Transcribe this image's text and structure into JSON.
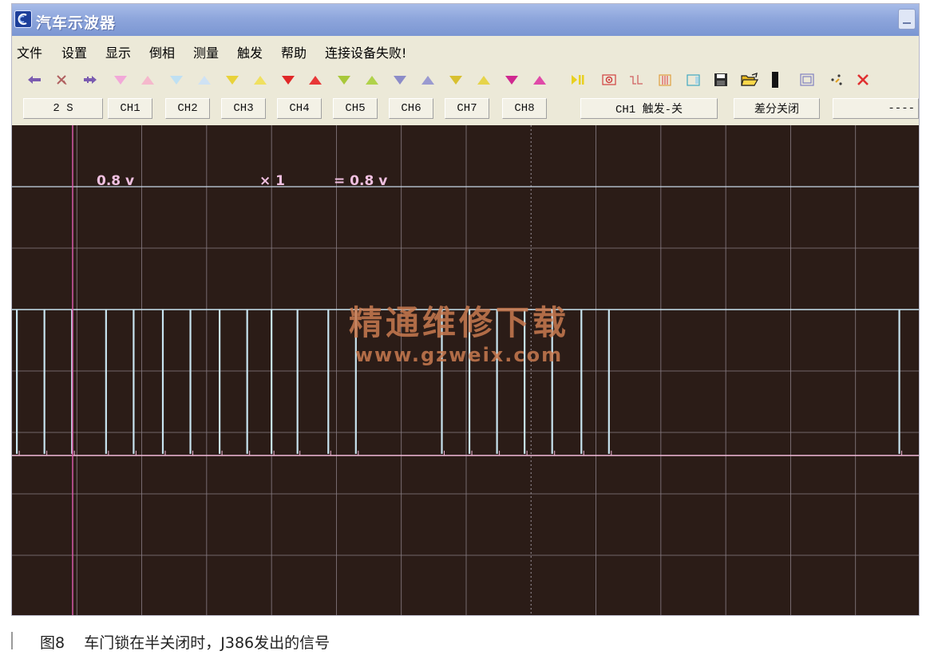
{
  "window": {
    "title": "汽车示波器"
  },
  "menu": [
    "文件",
    "设置",
    "显示",
    "倒相",
    "测量",
    "触发",
    "帮助",
    "连接设备失败!"
  ],
  "toolbar": {
    "nav": [
      {
        "icon": "arrow-left-icon",
        "color": "#7a5bb0"
      },
      {
        "icon": "x-cursor-icon",
        "color": "#b06060"
      },
      {
        "icon": "arrow-right-icon",
        "color": "#7a5bb0"
      }
    ],
    "channel_arrows": [
      {
        "channel": "CH1",
        "down": "#f2a8d8",
        "up": "#f5b8cc"
      },
      {
        "channel": "CH2",
        "down": "#bfe0f2",
        "up": "#cfe2f4"
      },
      {
        "channel": "CH3",
        "down": "#e8d23a",
        "up": "#f0e060"
      },
      {
        "channel": "CH4",
        "down": "#e02828",
        "up": "#e83838"
      },
      {
        "channel": "CH5",
        "down": "#a8c83a",
        "up": "#b0d24a"
      },
      {
        "channel": "CH6",
        "down": "#8c8cc8",
        "up": "#9a9ad0"
      },
      {
        "channel": "CH7",
        "down": "#d8c030",
        "up": "#e6d44a"
      },
      {
        "channel": "CH8",
        "down": "#d02890",
        "up": "#e04aa8"
      }
    ],
    "tools": [
      "play-pause-icon",
      "record-icon",
      "pulse-icon",
      "bars-icon",
      "panel-icon",
      "save-icon",
      "open-folder-icon",
      "black-bar-icon",
      "frame-icon",
      "cursor-dots-icon",
      "close-icon"
    ]
  },
  "status": {
    "timebase": "2 S",
    "channels": [
      "CH1",
      "CH2",
      "CH3",
      "CH4",
      "CH5",
      "CH6",
      "CH7",
      "CH8"
    ],
    "trigger": "CH1 触发-关",
    "differential": "差分关闭",
    "extra": "----"
  },
  "scope": {
    "volts_div": "0.8 v",
    "multiplier": "× 1",
    "result": "= 0.8 v",
    "colors": {
      "background": "#2b1c17",
      "grid": "#8a7f86",
      "trace_high": "#c8e4f0",
      "trace_low": "#f2b8d8",
      "cursor": "#d85aa8",
      "label": "#f0c0e0"
    },
    "pulse_times_s": [
      0.03,
      0.2,
      0.37,
      0.58,
      0.75,
      0.93,
      1.1,
      1.28,
      1.45,
      1.6,
      1.76,
      1.95,
      2.12,
      2.65,
      2.82,
      2.99,
      3.16,
      3.33,
      3.51,
      3.68,
      5.47,
      5.64
    ],
    "high_level_v": 0.0,
    "low_level_v": -1.9
  },
  "watermark": {
    "title": "精通维修下载",
    "url": "www.gzweix.com"
  },
  "caption": {
    "figure": "图8",
    "text": "车门锁在半关闭时，J386发出的信号"
  }
}
